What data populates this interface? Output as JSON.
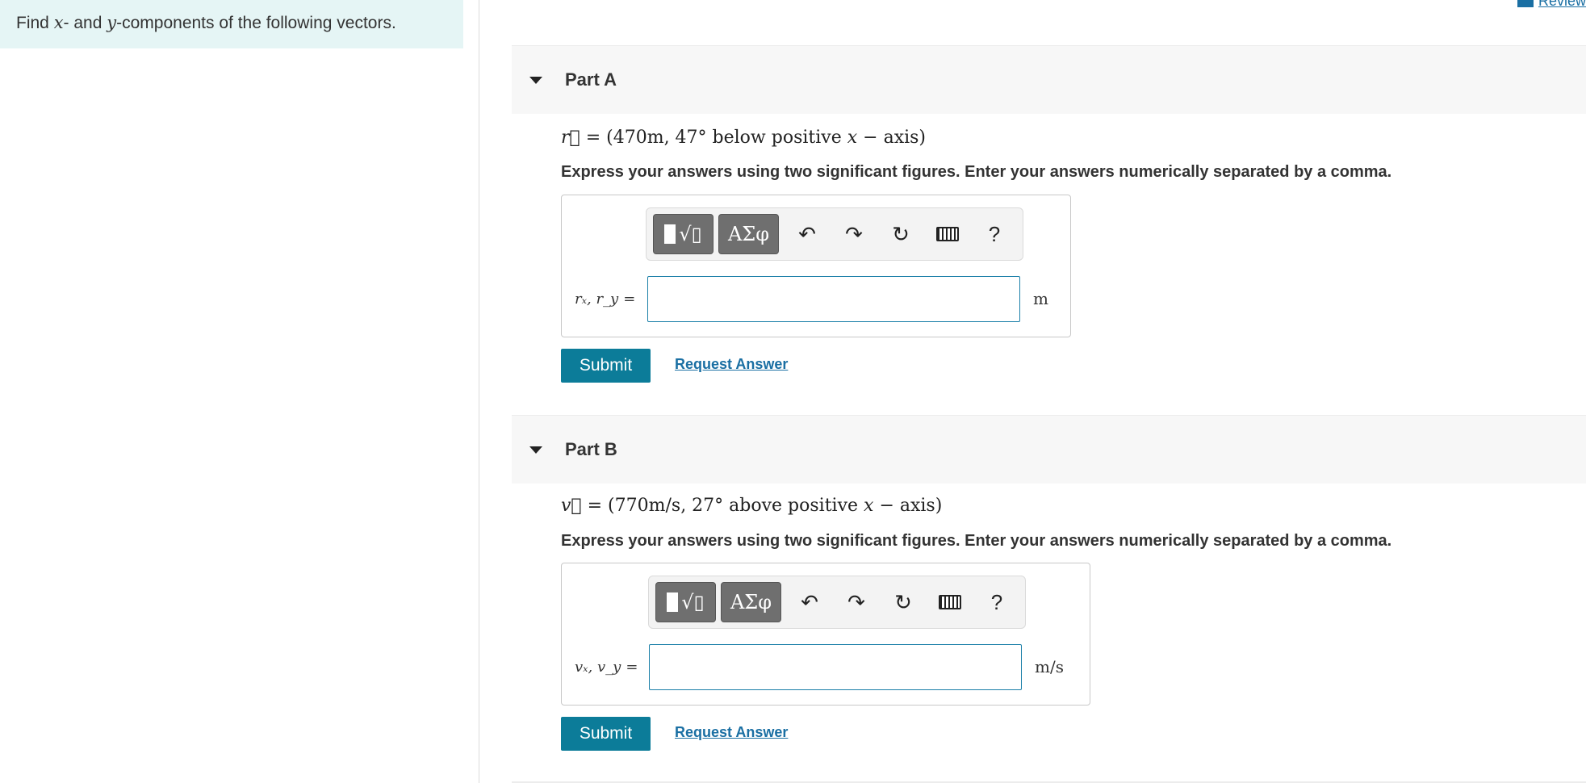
{
  "instructions": {
    "text_prefix": "Find ",
    "x_var": "x",
    "text_mid": "- and ",
    "y_var": "y",
    "text_suffix": "-components of the following vectors."
  },
  "header": {
    "review_label": "Review"
  },
  "parts": [
    {
      "title": "Part A",
      "vector_symbol": "r⃗",
      "vector_text": " = (470m,  47° below positive ",
      "axis_var": "x",
      "axis_text": " − axis)",
      "instruction": "Express your answers using two significant figures. Enter your answers numerically separated by a comma.",
      "var_label": "rₓ, r_y",
      "var_eq": "=",
      "input_value": "",
      "unit": "m",
      "submit_label": "Submit",
      "request_label": "Request Answer"
    },
    {
      "title": "Part B",
      "vector_symbol": "v⃗",
      "vector_text": " = (770m/s,  27° above positive ",
      "axis_var": "x",
      "axis_text": " − axis)",
      "instruction": "Express your answers using two significant figures. Enter your answers numerically separated by a comma.",
      "var_label": "vₓ, v_y",
      "var_eq": "=",
      "input_value": "",
      "unit": "m/s",
      "submit_label": "Submit",
      "request_label": "Request Answer"
    }
  ],
  "toolbar": {
    "greek_label": "ΑΣφ",
    "template_label": "√",
    "help_label": "?",
    "icons": [
      "templates-icon",
      "greek-icon",
      "undo-icon",
      "redo-icon",
      "reset-icon",
      "keyboard-icon",
      "help-icon"
    ]
  },
  "colors": {
    "accent": "#0c7c99",
    "link": "#1a6fa3",
    "instructions_bg": "#e5f5f5",
    "header_bg": "#f7f7f7"
  }
}
